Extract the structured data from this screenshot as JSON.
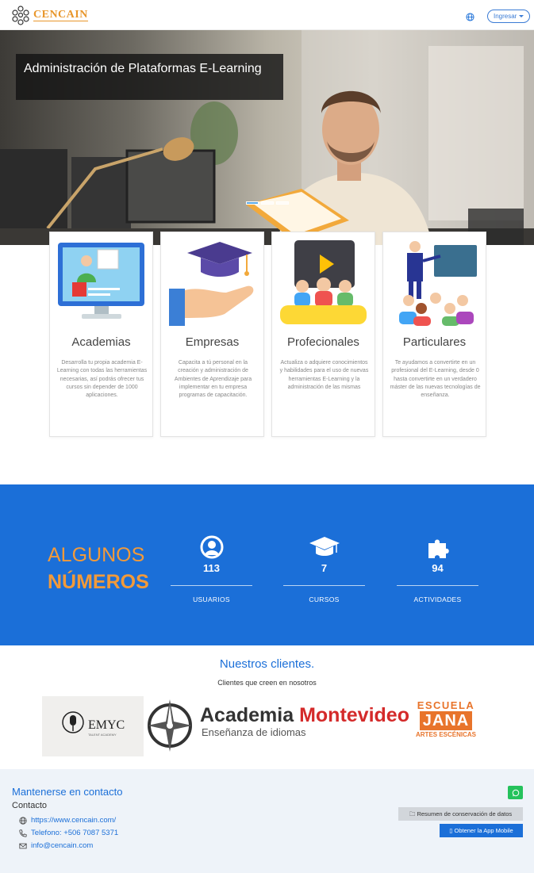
{
  "navbar": {
    "brand": "CENCAIN",
    "login_label": "Ingresar"
  },
  "hero": {
    "title": "Administración de Plataformas E-Learning",
    "slide_count": 3,
    "active_slide": 1
  },
  "cards": [
    {
      "title": "Academias",
      "description": "Desarrolla tu propia academia E-Learning con todas las herramientas necesarias, así podrás ofrecer tus cursos sin depender de 1000 aplicaciones.",
      "icon": "computer-teacher-icon"
    },
    {
      "title": "Empresas",
      "description": "Capacita a tú personal en la creación y administración de Ambientes de Aprendizaje para implementar en tu empresa programas de capacitación.",
      "icon": "graduation-hand-icon"
    },
    {
      "title": "Profecionales",
      "description": "Actualiza o adquiere conocimientos y habilidades para el uso de nuevas herramientas E-Learning y la administración de las mismas",
      "icon": "video-audience-icon"
    },
    {
      "title": "Particulares",
      "description": "Te ayudamos a convertirte en un profesional del E-Learning, desde 0 hasta convertirte en un verdadero máster de las nuevas tecnologías de enseñanza.",
      "icon": "presenter-class-icon"
    }
  ],
  "numbers": {
    "heading_1": "ALGUNOS",
    "heading_2": "NÚMEROS",
    "stats": [
      {
        "value": "113",
        "label": "USUARIOS",
        "icon": "user-icon"
      },
      {
        "value": "7",
        "label": "CURSOS",
        "icon": "graduation-cap-icon"
      },
      {
        "value": "94",
        "label": "ACTIVIDADES",
        "icon": "puzzle-icon"
      }
    ]
  },
  "clients": {
    "title": "Nuestros clientes.",
    "subtitle": "Clientes que creen en nosotros",
    "emyc": {
      "name": "EMYC",
      "tagline": "TALENT ACADEMY"
    },
    "montevideo": {
      "name_1": "Academia",
      "name_2": "Montevideo",
      "tagline": "Enseñanza de idiomas"
    },
    "jana": {
      "line_1": "ESCUELA",
      "line_2": "JANA",
      "line_3": "ARTES ESCÉNICAS"
    }
  },
  "footer": {
    "title": "Mantenerse en contacto",
    "contact_label": "Contacto",
    "website": "https://www.cencain.com/",
    "phone": "Telefono: +506 7087 5371",
    "email": "info@cencain.com",
    "data_summary_label": "Resumen de conservación de datos",
    "app_label": "Obtener la App Mobile"
  },
  "colors": {
    "primary_blue": "#1b6fd8",
    "accent_orange": "#f29a3a",
    "brand_gold": "#e8962b"
  }
}
